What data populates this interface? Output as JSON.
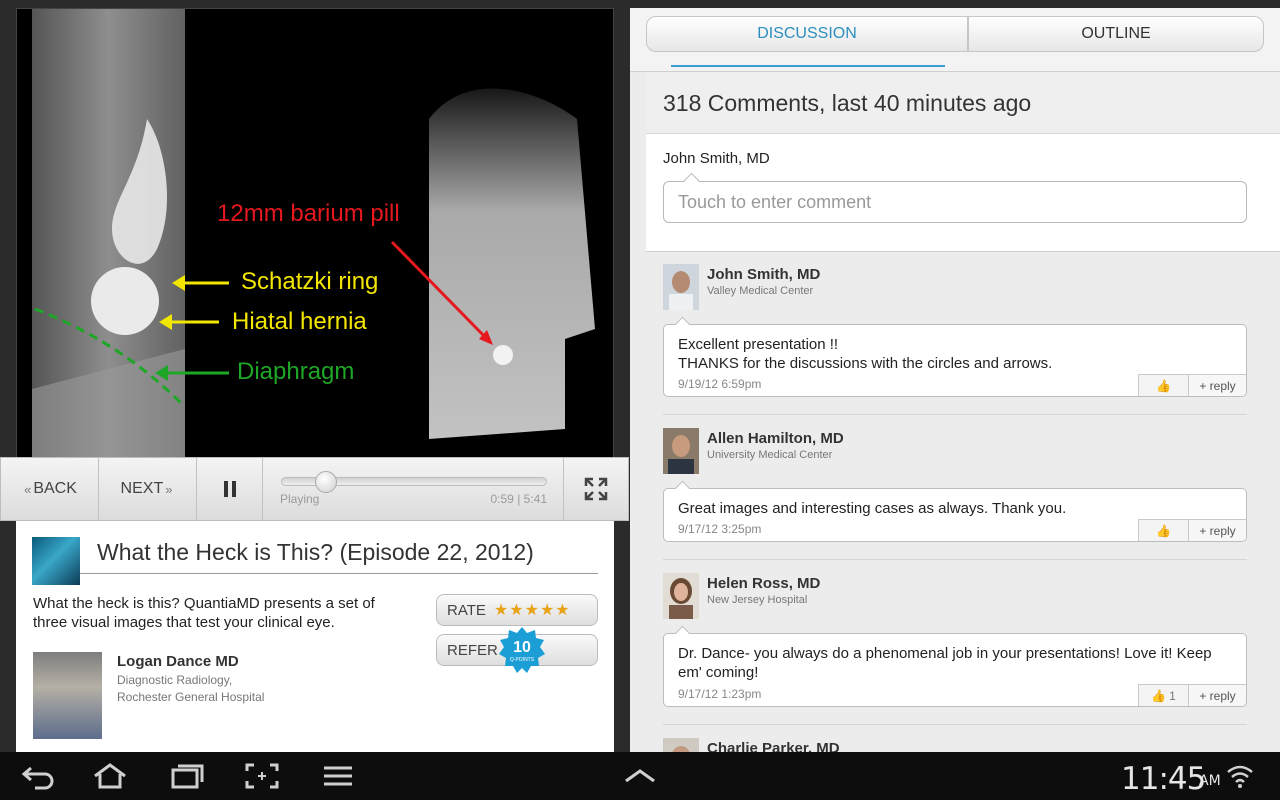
{
  "video": {
    "annotations": {
      "pill": "12mm barium pill",
      "ring": "Schatzki  ring",
      "hernia": "Hiatal hernia",
      "diaphragm": "Diaphragm"
    },
    "colors": {
      "pill": "#e4181d",
      "ring": "#f3e600",
      "diaphragm": "#1ea627"
    }
  },
  "controls": {
    "back_label": "BACK",
    "next_label": "NEXT",
    "status": "Playing",
    "time": "0:59 | 5:41",
    "progress_fraction": 0.17
  },
  "episode": {
    "title": "What the Heck is This? (Episode 22, 2012)",
    "description": "What the heck is this? QuantiaMD presents a set of three visual images that test your clinical eye.",
    "rate_label": "RATE",
    "rating_stars": "★★★★★",
    "refer_label": "REFER",
    "points": "10",
    "points_caption": "Q-POINTS",
    "author": {
      "name": "Logan Dance MD",
      "affiliation": "Diagnostic Radiology, Rochester General Hospital"
    }
  },
  "panel": {
    "tabs": [
      {
        "label": "DISCUSSION"
      },
      {
        "label": "OUTLINE"
      }
    ],
    "comments_header": "318 Comments, last 40 minutes ago",
    "current_user": "John Smith, MD",
    "comment_placeholder": "Touch to enter comment",
    "reply_label": "+ reply",
    "comments": [
      {
        "name": "John Smith, MD",
        "org": "Valley Medical Center",
        "text": "Excellent presentation !!\nTHANKS for the discussions with the circles and arrows.",
        "date": "9/19/12 6:59pm",
        "likes": ""
      },
      {
        "name": "Allen Hamilton, MD",
        "org": "University Medical Center",
        "text": "Great images and interesting cases as always. Thank you.",
        "date": "9/17/12 3:25pm",
        "likes": ""
      },
      {
        "name": "Helen Ross, MD",
        "org": "New Jersey Hospital",
        "text": "Dr. Dance- you always do a phenomenal job in your presentations! Love it! Keep em' coming!",
        "date": "9/17/12 1:23pm",
        "likes": "1"
      },
      {
        "name": "Charlie Parker, MD",
        "org": "",
        "text": "",
        "date": "",
        "likes": ""
      }
    ]
  },
  "system": {
    "clock": "11:45",
    "ampm": "AM"
  }
}
